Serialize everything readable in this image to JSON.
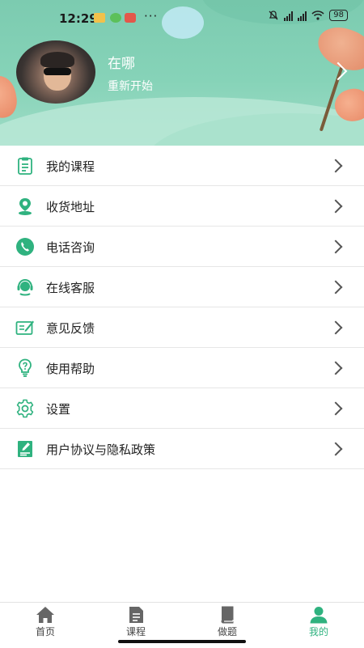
{
  "status_bar": {
    "time": "12:29",
    "dots": "···",
    "battery": "98"
  },
  "profile": {
    "name": "在哪",
    "subtitle": "重新开始"
  },
  "menu": {
    "items": [
      {
        "label": "我的课程",
        "icon": "course-icon"
      },
      {
        "label": "收货地址",
        "icon": "location-icon"
      },
      {
        "label": "电话咨询",
        "icon": "phone-icon"
      },
      {
        "label": "在线客服",
        "icon": "customer-service-icon"
      },
      {
        "label": "意见反馈",
        "icon": "feedback-icon"
      },
      {
        "label": "使用帮助",
        "icon": "help-bulb-icon"
      },
      {
        "label": "设置",
        "icon": "gear-icon"
      },
      {
        "label": "用户协议与隐私政策",
        "icon": "agreement-icon"
      }
    ]
  },
  "bottom_nav": {
    "tabs": [
      {
        "label": "首页",
        "icon": "home-icon"
      },
      {
        "label": "课程",
        "icon": "course-doc-icon"
      },
      {
        "label": "做题",
        "icon": "book-icon"
      },
      {
        "label": "我的",
        "icon": "user-icon",
        "active": true
      }
    ]
  },
  "colors": {
    "accent": "#2fb27f",
    "header": "#86d3b8"
  }
}
